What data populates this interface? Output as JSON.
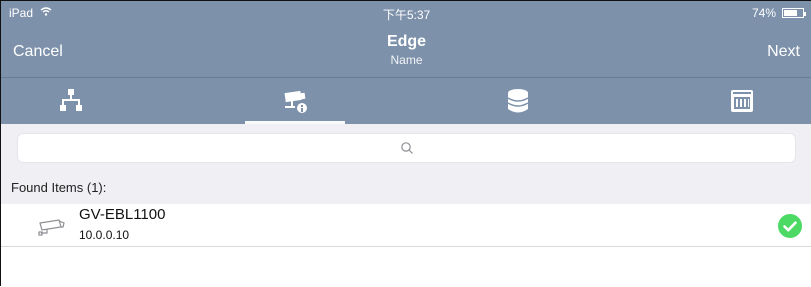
{
  "status_bar": {
    "device": "iPad",
    "time": "下午5:37",
    "battery_text": "74%",
    "battery_level": 0.74
  },
  "nav": {
    "cancel_label": "Cancel",
    "title": "Edge",
    "subtitle": "Name",
    "next_label": "Next"
  },
  "tabs": [
    {
      "icon": "network-icon",
      "selected": false
    },
    {
      "icon": "camera-info-icon",
      "selected": true
    },
    {
      "icon": "database-icon",
      "selected": false
    },
    {
      "icon": "storage-device-icon",
      "selected": false
    }
  ],
  "search": {
    "placeholder": ""
  },
  "found": {
    "header": "Found Items (1):",
    "items": [
      {
        "name": "GV-EBL1100",
        "ip": "10.0.0.10",
        "icon": "camera-icon",
        "status_icon": "check-icon"
      }
    ]
  },
  "colors": {
    "bar": "#7d91ab",
    "background": "#efeff4",
    "check": "#4cd964"
  }
}
